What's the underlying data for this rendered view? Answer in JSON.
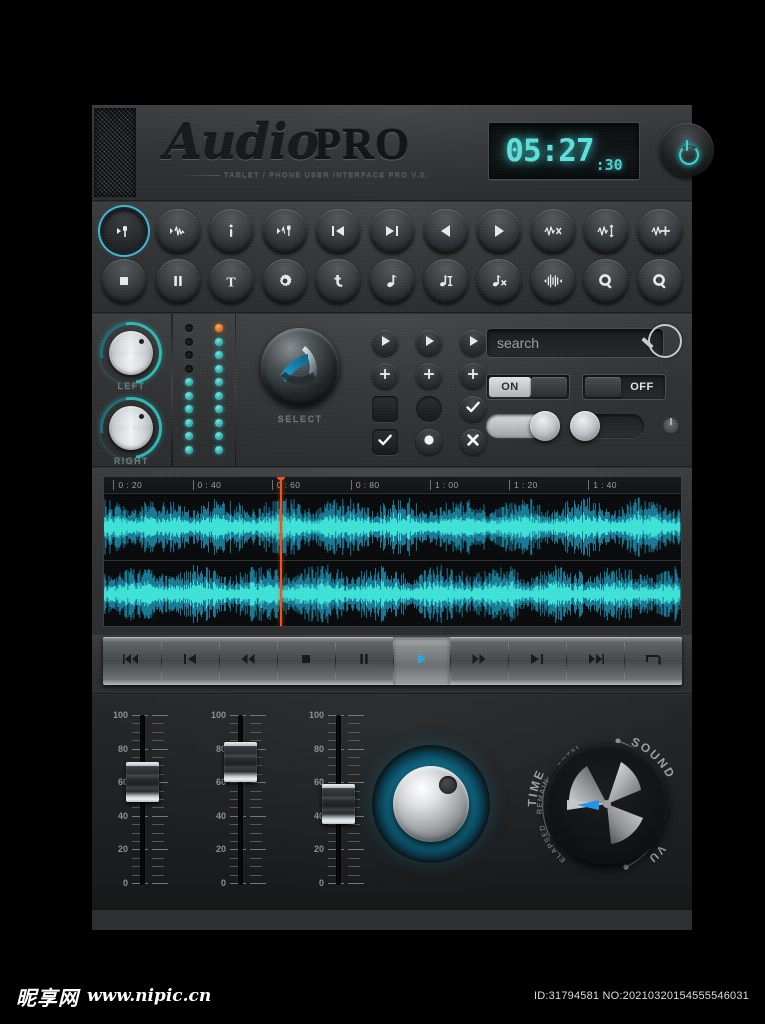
{
  "header": {
    "brand_audio": "Audio",
    "brand_pro": "PRO",
    "subtitle": "TABLET / PHONE USER INTERFACE PRO V.3.",
    "clock_main": "05:27",
    "clock_seconds": ":30",
    "power_icon": "power-icon"
  },
  "toolbar": {
    "row1": [
      {
        "name": "marker-start-button",
        "icon": "marker-start-icon",
        "active": true
      },
      {
        "name": "waveform-marker-button",
        "icon": "waveform-marker-icon",
        "active": false
      },
      {
        "name": "info-button",
        "icon": "info-icon",
        "active": false
      },
      {
        "name": "marker-wave-button",
        "icon": "marker-wave-icon",
        "active": false
      },
      {
        "name": "skip-previous-button",
        "icon": "skip-previous-icon",
        "active": false
      },
      {
        "name": "skip-next-button",
        "icon": "skip-next-icon",
        "active": false
      },
      {
        "name": "rewind-button",
        "icon": "play-left-icon",
        "active": false
      },
      {
        "name": "play-button",
        "icon": "play-right-icon",
        "active": false
      },
      {
        "name": "wave-delete-button",
        "icon": "wave-x-icon",
        "active": false
      },
      {
        "name": "wave-amplitude-button",
        "icon": "wave-updown-icon",
        "active": false
      },
      {
        "name": "wave-add-button",
        "icon": "wave-plus-icon",
        "active": false
      }
    ],
    "row2": [
      {
        "name": "stop-button",
        "icon": "stop-icon"
      },
      {
        "name": "pause-button",
        "icon": "pause-icon"
      },
      {
        "name": "text-tool-button",
        "icon": "text-t-icon"
      },
      {
        "name": "settings-button",
        "icon": "gear-icon"
      },
      {
        "name": "cursor-tool-button",
        "icon": "cursor-icon"
      },
      {
        "name": "note-button",
        "icon": "music-note-icon"
      },
      {
        "name": "note-edit-button",
        "icon": "note-text-icon"
      },
      {
        "name": "note-delete-button",
        "icon": "note-x-icon"
      },
      {
        "name": "trim-button",
        "icon": "trim-wave-icon"
      },
      {
        "name": "zoom-in-button",
        "icon": "zoom-in-icon"
      },
      {
        "name": "zoom-out-button",
        "icon": "zoom-out-icon"
      }
    ]
  },
  "mid": {
    "knob_left_label": "LEFT",
    "knob_right_label": "RIGHT",
    "select_label": "SELECT",
    "leds": {
      "column_left": [
        "off",
        "off",
        "off",
        "off",
        "cy",
        "cy",
        "cy",
        "cy",
        "cy",
        "cy"
      ],
      "column_right": [
        "or",
        "cy",
        "cy",
        "cy",
        "cy",
        "cy",
        "cy",
        "cy",
        "cy",
        "cy"
      ]
    },
    "pads": [
      {
        "name": "pad-play-1",
        "icon": "play-icon"
      },
      {
        "name": "pad-play-2",
        "icon": "play-icon"
      },
      {
        "name": "pad-play-3",
        "icon": "play-icon"
      },
      {
        "name": "pad-plus-1",
        "icon": "plus-icon"
      },
      {
        "name": "pad-plus-2",
        "icon": "plus-icon"
      },
      {
        "name": "pad-plus-3",
        "icon": "plus-icon"
      },
      {
        "name": "checkbox-unchecked",
        "icon": "square-empty-icon"
      },
      {
        "name": "radio-unchecked",
        "icon": "circle-empty-icon"
      },
      {
        "name": "confirm-circle",
        "icon": "check-icon"
      },
      {
        "name": "checkbox-checked",
        "icon": "check-square-icon"
      },
      {
        "name": "radio-checked",
        "icon": "circle-filled-icon"
      },
      {
        "name": "cancel-circle",
        "icon": "x-icon"
      }
    ],
    "search_placeholder": "search",
    "search_value": "",
    "search_icon": "search-icon",
    "toggle_on_label": "ON",
    "toggle_off_label": "OFF"
  },
  "timeline": {
    "ticks": [
      "0 : 20",
      "0 : 40",
      "0 : 60",
      "0 : 80",
      "1 : 00",
      "1 : 20",
      "1 : 40"
    ],
    "playhead_position_pct": 30.5,
    "playhead_color": "#f2541b",
    "waveform_color": "#3fe8dc"
  },
  "transport": [
    {
      "name": "transport-rewind-start",
      "icon": "rewind-double-icon",
      "active": false
    },
    {
      "name": "transport-previous",
      "icon": "skip-previous-icon",
      "active": false
    },
    {
      "name": "transport-rewind",
      "icon": "rewind-icon",
      "active": false
    },
    {
      "name": "transport-stop",
      "icon": "stop-icon",
      "active": false
    },
    {
      "name": "transport-pause",
      "icon": "pause-icon",
      "active": false
    },
    {
      "name": "transport-play",
      "icon": "play-icon",
      "active": true
    },
    {
      "name": "transport-fast-forward",
      "icon": "forward-icon",
      "active": false
    },
    {
      "name": "transport-next",
      "icon": "skip-next-icon",
      "active": false
    },
    {
      "name": "transport-forward-end",
      "icon": "forward-double-icon",
      "active": false
    },
    {
      "name": "transport-loop",
      "icon": "loop-icon",
      "active": false
    }
  ],
  "mixer": {
    "scale_labels": [
      "100",
      "80",
      "60",
      "40",
      "20",
      "0"
    ],
    "faders": [
      {
        "name": "fader-1",
        "value": 60
      },
      {
        "name": "fader-2",
        "value": 72
      },
      {
        "name": "fader-3",
        "value": 47
      }
    ],
    "big_knob_name": "volume-knob",
    "dial_labels": {
      "sound": "SOUND",
      "time": "TIME",
      "total": "TOTAL",
      "remaining": "REMAINING",
      "elapsed": "ELAPSED",
      "vu": "VU"
    }
  },
  "footer": {
    "site_cn": "昵享网",
    "site_url": "www.nipic.cn",
    "id_text": "ID:31794581 NO:20210320154555546031"
  }
}
